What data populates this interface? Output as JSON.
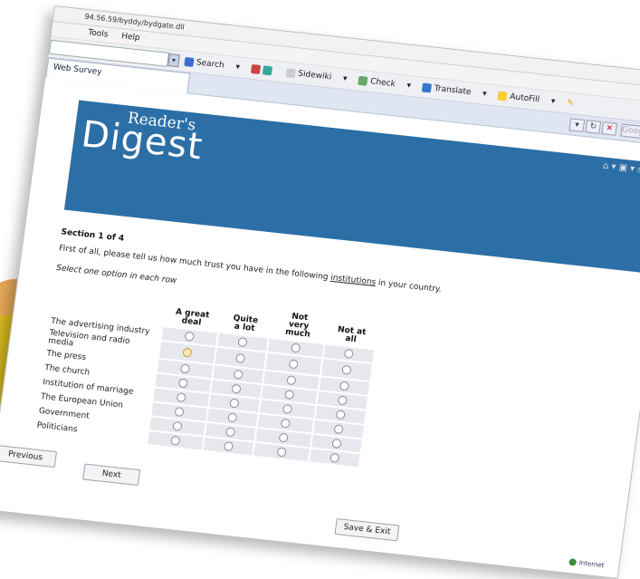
{
  "browser": {
    "url": "94.56.59/byddy/bydgate.dll",
    "menu": [
      "Tools",
      "Help"
    ],
    "toolbar": {
      "search": "Search",
      "sidewiki": "Sidewiki",
      "check": "Check",
      "translate": "Translate",
      "autofill": "AutoFill"
    },
    "tab_title": "Web Survey",
    "search_engine_placeholder": "Google"
  },
  "logo": {
    "line1": "Reader's",
    "line2": "Digest"
  },
  "section": {
    "title": "Section 1 of 4",
    "intro_before": "First of all, please tell us how much trust you have in the following ",
    "intro_link": "institutions",
    "intro_after": " in your country.",
    "instruction": "Select one option in each row"
  },
  "grid": {
    "columns": [
      "A great deal",
      "Quite a lot",
      "Not very much",
      "Not at all"
    ],
    "rows": [
      {
        "label": "The advertising industry",
        "selected": null
      },
      {
        "label": "Television and radio media",
        "selected": 0
      },
      {
        "label": "The press",
        "selected": null
      },
      {
        "label": "The church",
        "selected": null
      },
      {
        "label": "Institution of marriage",
        "selected": null
      },
      {
        "label": "The European Union",
        "selected": null
      },
      {
        "label": "Government",
        "selected": null
      },
      {
        "label": "Politicians",
        "selected": null
      }
    ]
  },
  "buttons": {
    "previous": "Previous",
    "next": "Next",
    "save_exit": "Save & Exit"
  },
  "status": {
    "zone": "Internet"
  },
  "colors": {
    "banner": "#2b6fa6",
    "accent": "#d9bc1e"
  }
}
